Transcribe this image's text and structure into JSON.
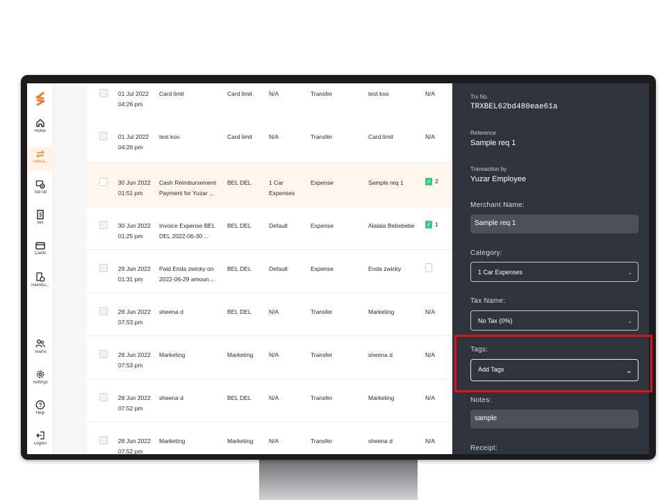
{
  "brand": {
    "accent": "#f07a2c",
    "panel_bg": "#2f333b",
    "highlight": "#e3101a"
  },
  "sidebar": {
    "top_items": [
      {
        "label": "Home",
        "icon": "home-icon"
      },
      {
        "label": "Transa...",
        "icon": "transfer-icon",
        "active": true
      },
      {
        "label": "Top Up",
        "icon": "topup-icon"
      },
      {
        "label": "Bill",
        "icon": "bill-icon"
      },
      {
        "label": "Cards",
        "icon": "card-icon"
      },
      {
        "label": "Reimbu...",
        "icon": "reimburse-icon"
      }
    ],
    "bottom_items": [
      {
        "label": "Teams",
        "icon": "teams-icon"
      },
      {
        "label": "Settings",
        "icon": "gear-icon"
      },
      {
        "label": "Help",
        "icon": "help-icon"
      },
      {
        "label": "Logout",
        "icon": "logout-icon"
      }
    ]
  },
  "rows": [
    {
      "date": "01 Jul 2022",
      "time": "04:26 pm",
      "desc": "Card limit",
      "vendor": "Card limit",
      "category": "N/A",
      "type": "Transfer",
      "reference": "test koo",
      "receipt": "N/A"
    },
    {
      "date": "01 Jul 2022",
      "time": "04:26 pm",
      "desc": "test koo",
      "vendor": "Card limit",
      "category": "N/A",
      "type": "Transfer",
      "reference": "Card limit",
      "receipt": "N/A"
    },
    {
      "date": "30 Jun 2022",
      "time": "01:51 pm",
      "desc": "Cash Reimbursement Payment for Yuzar ...",
      "vendor": "BEL DEL",
      "category": "1 Car Expenses",
      "type": "Expense",
      "reference": "Sample req 1",
      "receipt": "2",
      "receipt_kind": "badge",
      "highlight": true
    },
    {
      "date": "30 Jun 2022",
      "time": "01:25 pm",
      "desc": "Invoice Expense BEL DEL 2022-06-30 ...",
      "vendor": "BEL DEL",
      "category": "Default",
      "type": "Expense",
      "reference": "Alalala Bebebebe",
      "receipt": "1",
      "receipt_kind": "badge"
    },
    {
      "date": "29 Jun 2022",
      "time": "01:31 pm",
      "desc": "Paid Enda zwicky on 2022-06-29 amoun...",
      "vendor": "BEL DEL",
      "category": "Default",
      "type": "Expense",
      "reference": "Enda zwicky",
      "receipt": "",
      "receipt_kind": "empty"
    },
    {
      "date": "28 Jun 2022",
      "time": "07:53 pm",
      "desc": "sheena d",
      "vendor": "BEL DEL",
      "category": "N/A",
      "type": "Transfer",
      "reference": "Marketing",
      "receipt": "N/A"
    },
    {
      "date": "28 Jun 2022",
      "time": "07:53 pm",
      "desc": "Marketing",
      "vendor": "Marketing",
      "category": "N/A",
      "type": "Transfer",
      "reference": "sheena d",
      "receipt": "N/A"
    },
    {
      "date": "28 Jun 2022",
      "time": "07:52 pm",
      "desc": "sheena d",
      "vendor": "BEL DEL",
      "category": "N/A",
      "type": "Transfer",
      "reference": "Marketing",
      "receipt": "N/A"
    },
    {
      "date": "28 Jun 2022",
      "time": "07:52 pm",
      "desc": "Marketing",
      "vendor": "Marketing",
      "category": "N/A",
      "type": "Transfer",
      "reference": "sheena d",
      "receipt": "N/A"
    }
  ],
  "panel": {
    "trx_label": "Trx No.",
    "trx_value": "TRXBEL62bd480eae61a",
    "reference_label": "Reference",
    "reference_value": "Sample req 1",
    "transaction_by_label": "Transaction by",
    "transaction_by_value": "Yuzar Employee",
    "merchant_label": "Merchant Name:",
    "merchant_value": "Sample req 1",
    "category_label": "Category:",
    "category_value": "1 Car Expenses",
    "tax_label": "Tax Name:",
    "tax_value": "No Tax (0%)",
    "tags_label": "Tags:",
    "tags_value": "Add Tags",
    "notes_label": "Notes:",
    "notes_value": "sample",
    "receipt_label": "Receipt:"
  }
}
